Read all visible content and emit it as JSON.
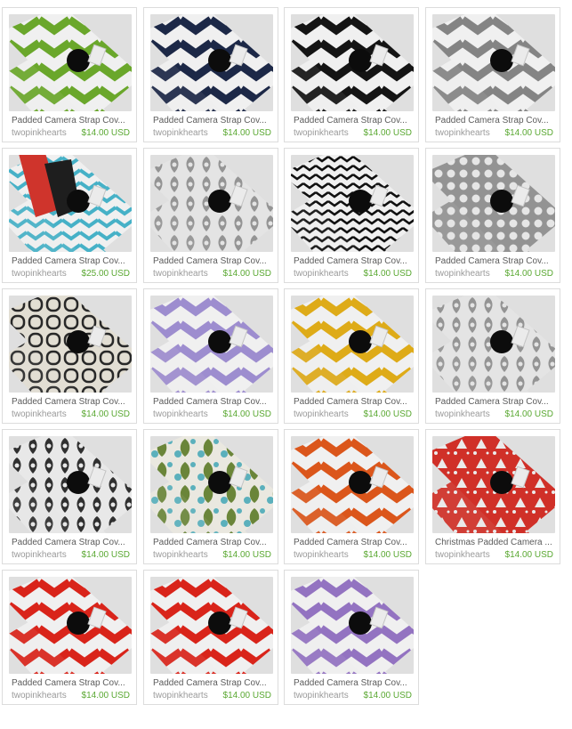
{
  "items": [
    {
      "title": "Padded Camera Strap Cov...",
      "shop": "twopinkhearts",
      "price": "$14.00 USD",
      "pattern": "chevron",
      "color": "#6fae2d"
    },
    {
      "title": "Padded Camera Strap Cov...",
      "shop": "twopinkhearts",
      "price": "$14.00 USD",
      "pattern": "chevron",
      "color": "#1e2a4a"
    },
    {
      "title": "Padded Camera Strap Cov...",
      "shop": "twopinkhearts",
      "price": "$14.00 USD",
      "pattern": "chevron",
      "color": "#151515"
    },
    {
      "title": "Padded Camera Strap Cov...",
      "shop": "twopinkhearts",
      "price": "$14.00 USD",
      "pattern": "chevron",
      "color": "#8a8a8a"
    },
    {
      "title": "Padded Camera Strap Cov...",
      "shop": "twopinkhearts",
      "price": "$25.00 USD",
      "pattern": "mixed",
      "color": "#49b9d0"
    },
    {
      "title": "Padded Camera Strap Cov...",
      "shop": "twopinkhearts",
      "price": "$14.00 USD",
      "pattern": "damask",
      "color": "#8d8d8d"
    },
    {
      "title": "Padded Camera Strap Cov...",
      "shop": "twopinkhearts",
      "price": "$14.00 USD",
      "pattern": "chevron-small",
      "color": "#111111"
    },
    {
      "title": "Padded Camera Strap Cov...",
      "shop": "twopinkhearts",
      "price": "$14.00 USD",
      "pattern": "dots",
      "color": "#9a9a9a"
    },
    {
      "title": "Padded Camera Strap Cov...",
      "shop": "twopinkhearts",
      "price": "$14.00 USD",
      "pattern": "lattice",
      "color": "#2a2a2a"
    },
    {
      "title": "Padded Camera Strap Cov...",
      "shop": "twopinkhearts",
      "price": "$14.00 USD",
      "pattern": "chevron",
      "color": "#a493d8"
    },
    {
      "title": "Padded Camera Strap Cov...",
      "shop": "twopinkhearts",
      "price": "$14.00 USD",
      "pattern": "chevron",
      "color": "#e8b21a"
    },
    {
      "title": "Padded Camera Strap Cov...",
      "shop": "twopinkhearts",
      "price": "$14.00 USD",
      "pattern": "damask",
      "color": "#8d8d8d"
    },
    {
      "title": "Padded Camera Strap Cov...",
      "shop": "twopinkhearts",
      "price": "$14.00 USD",
      "pattern": "damask",
      "color": "#101010"
    },
    {
      "title": "Padded Camera Strap Cov...",
      "shop": "twopinkhearts",
      "price": "$14.00 USD",
      "pattern": "floral",
      "color": "#6f8b3c"
    },
    {
      "title": "Padded Camera Strap Cov...",
      "shop": "twopinkhearts",
      "price": "$14.00 USD",
      "pattern": "chevron",
      "color": "#e45a1d"
    },
    {
      "title": "Christmas Padded Camera ...",
      "shop": "twopinkhearts",
      "price": "$14.00 USD",
      "pattern": "holiday",
      "color": "#d9322a"
    },
    {
      "title": "Padded Camera Strap Cov...",
      "shop": "twopinkhearts",
      "price": "$14.00 USD",
      "pattern": "chevron",
      "color": "#e2261c"
    },
    {
      "title": "Padded Camera Strap Cov...",
      "shop": "twopinkhearts",
      "price": "$14.00 USD",
      "pattern": "chevron",
      "color": "#e2261c"
    },
    {
      "title": "Padded Camera Strap Cov...",
      "shop": "twopinkhearts",
      "price": "$14.00 USD",
      "pattern": "chevron",
      "color": "#9a78c9"
    }
  ]
}
